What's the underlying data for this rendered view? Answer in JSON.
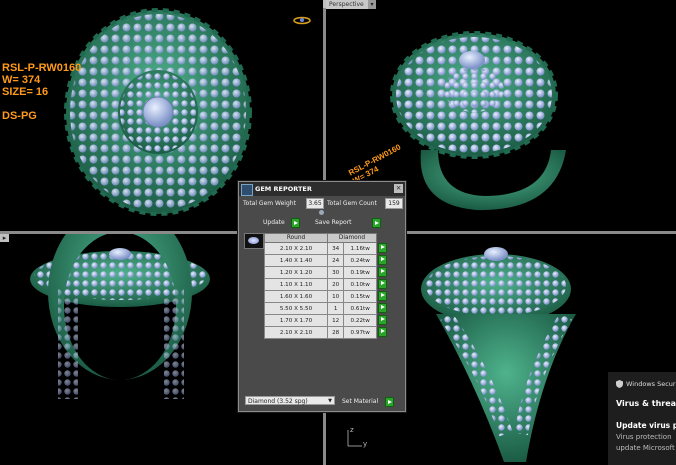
{
  "top_left_label": {
    "line1": "RSL-P-RW0160",
    "line2": "W= 374",
    "line3": "SIZE= 16",
    "line4": "DS-PG"
  },
  "viewport_top_right": {
    "mode": "Perspective",
    "mode_dropdown": "▾",
    "rotated_label": "RSL-P-RW0160\nW= 374"
  },
  "axis_gizmo": {
    "z": "z",
    "y": "y"
  },
  "gem_reporter": {
    "title": "GEM REPORTER",
    "close": "×",
    "total_weight_label": "Total Gem Weight",
    "total_weight_value": "3.65",
    "total_count_label": "Total Gem Count",
    "total_count_value": "159",
    "update_label": "Update",
    "save_report_label": "Save Report",
    "col_shape": "Round",
    "col_material": "Diamond",
    "rows": [
      {
        "size": "2.10 X 2.10",
        "count": "34",
        "weight": "1.16tw"
      },
      {
        "size": "1.40 X 1.40",
        "count": "24",
        "weight": "0.24tw"
      },
      {
        "size": "1.20 X 1.20",
        "count": "30",
        "weight": "0.19tw"
      },
      {
        "size": "1.10 X 1.10",
        "count": "20",
        "weight": "0.10tw"
      },
      {
        "size": "1.60 X 1.60",
        "count": "10",
        "weight": "0.15tw"
      },
      {
        "size": "5.50 X 5.50",
        "count": "1",
        "weight": "0.61tw"
      },
      {
        "size": "1.70 X 1.70",
        "count": "12",
        "weight": "0.22tw"
      },
      {
        "size": "2.10 X 2.10",
        "count": "28",
        "weight": "0.97tw"
      }
    ],
    "material_select": "Diamond      (3.52 spg)",
    "set_material_label": "Set Material"
  },
  "notification": {
    "header": "Windows Securi",
    "title": "Virus & threat p",
    "subtitle": "Update virus pro",
    "body_line1": "Virus protection",
    "body_line2": "update Microsoft"
  },
  "colors": {
    "metal": "#2e8c6a",
    "gem": "#a9bde8",
    "label_orange": "#ff9a1a",
    "panel_bg": "#4a4a4a"
  }
}
